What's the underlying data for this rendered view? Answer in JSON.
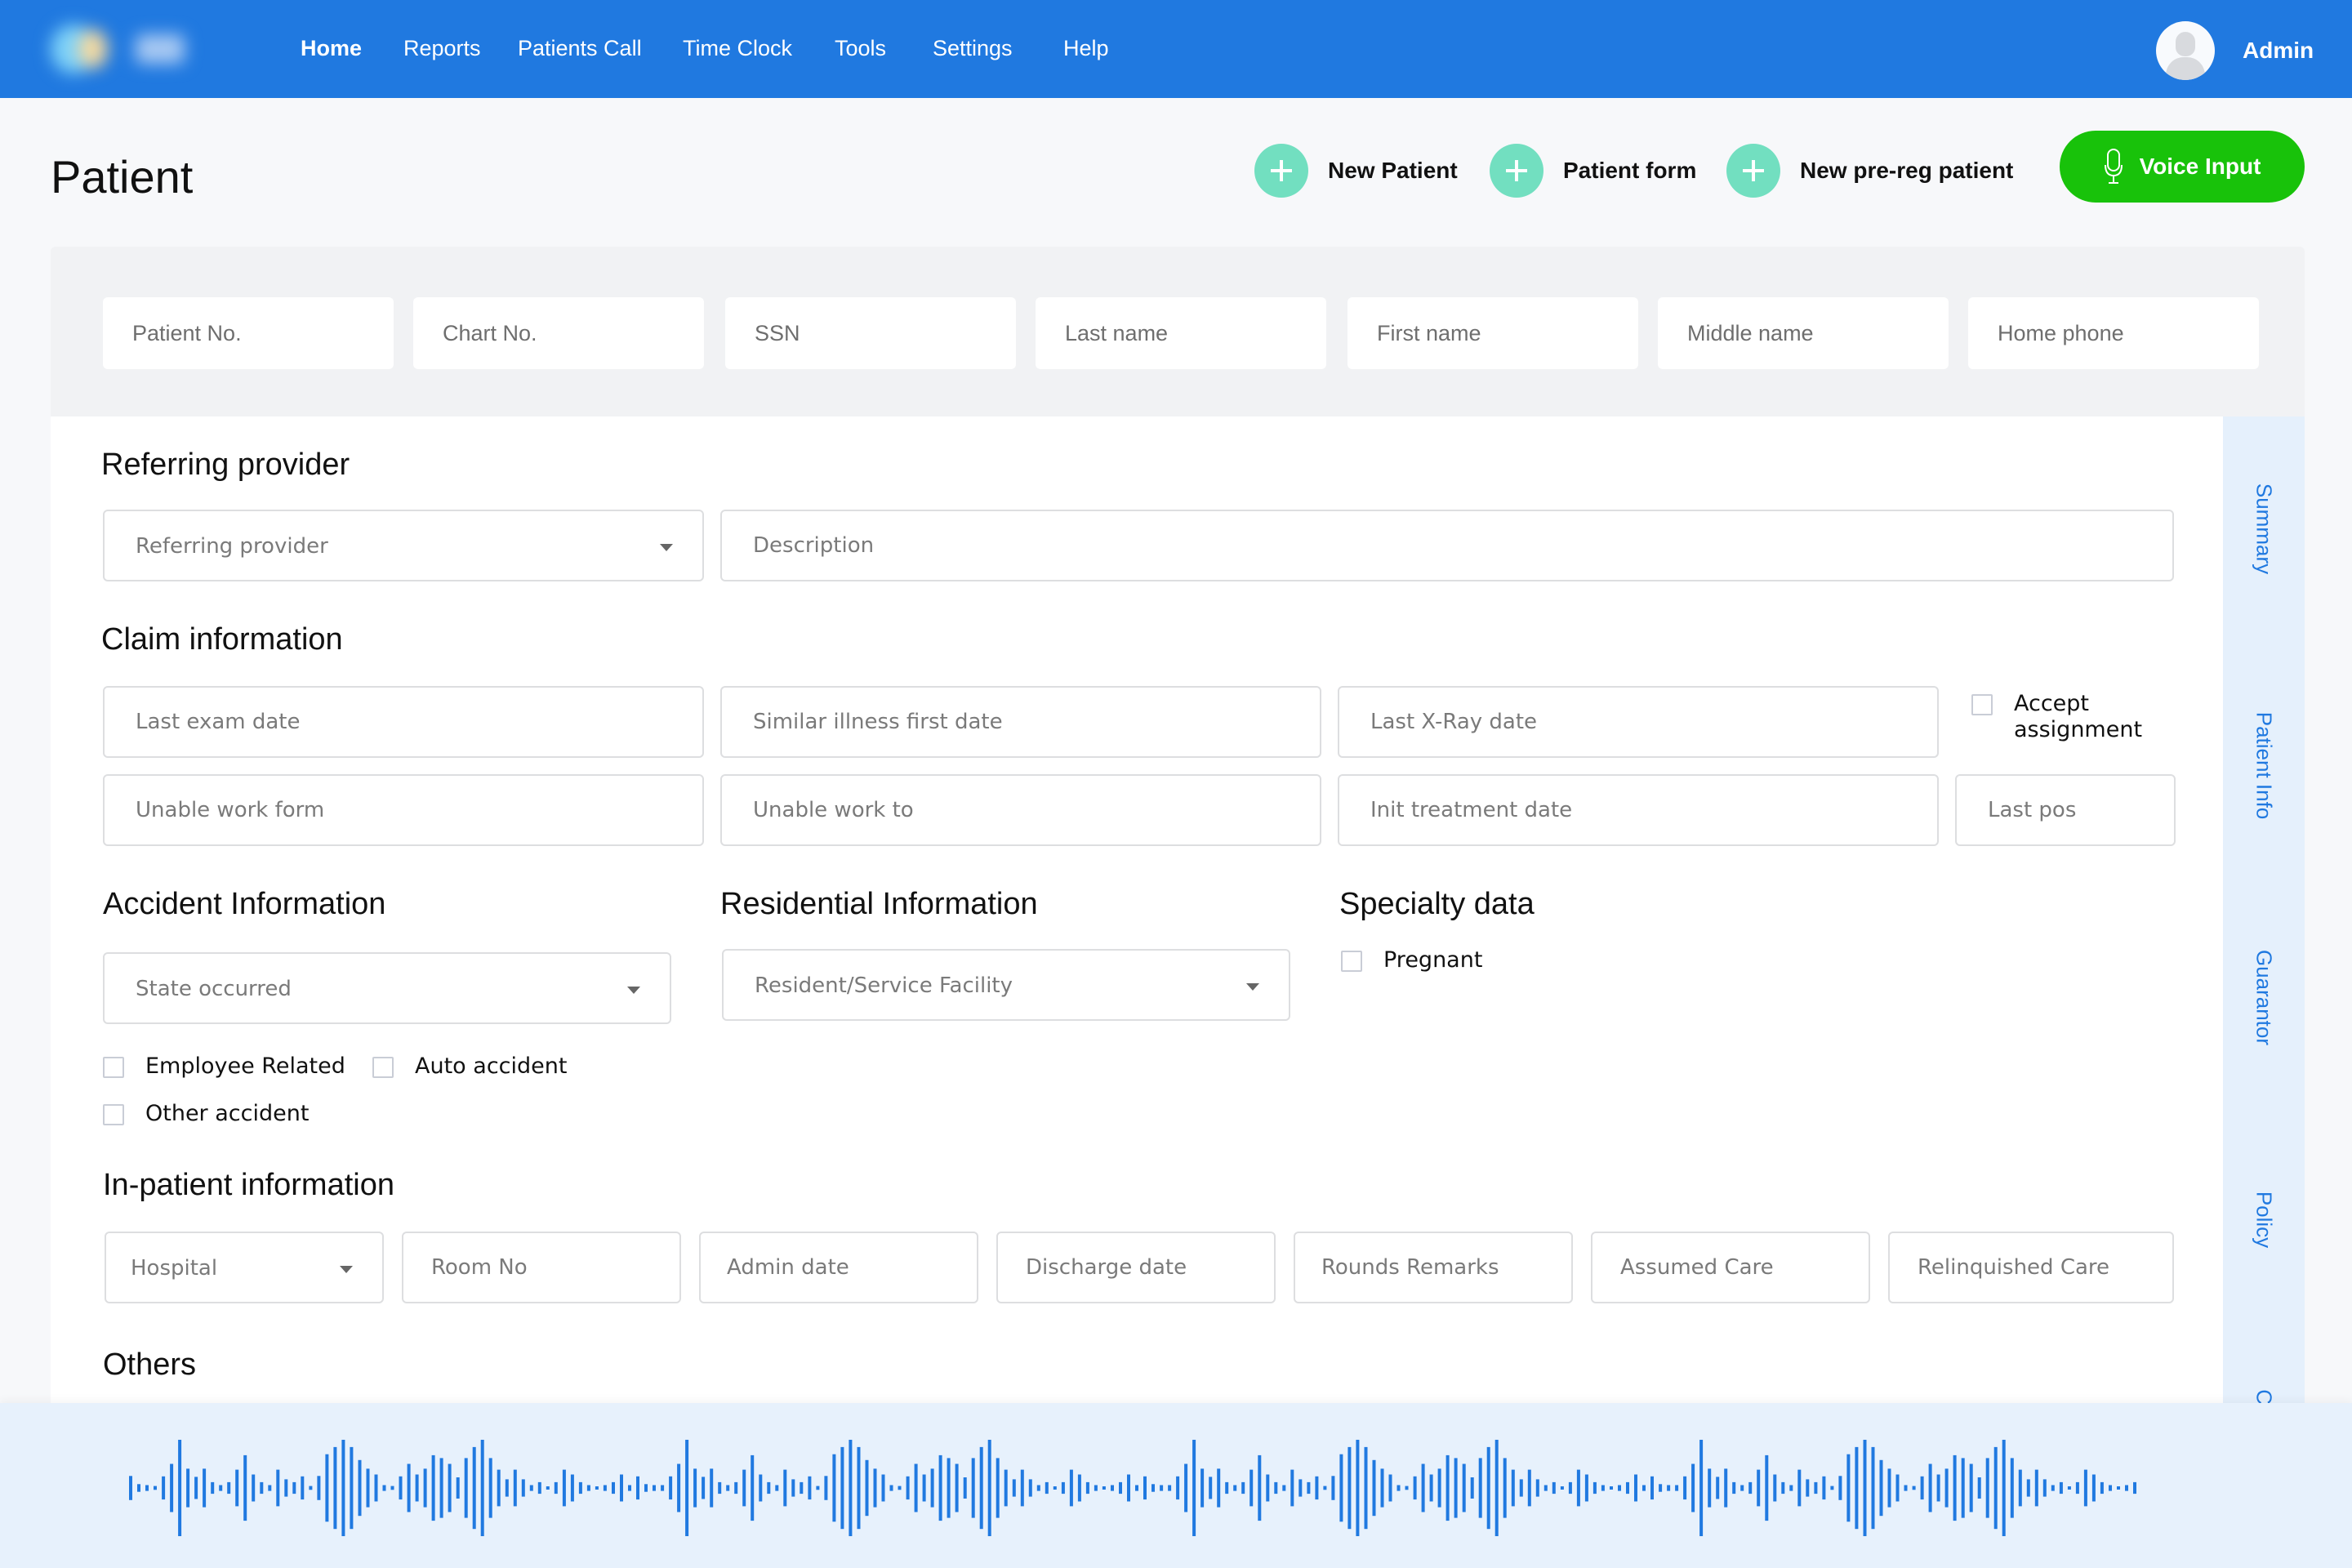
{
  "header": {
    "nav": [
      {
        "label": "Home",
        "active": true
      },
      {
        "label": "Reports",
        "active": false
      },
      {
        "label": "Patients Call",
        "active": false
      },
      {
        "label": "Time Clock",
        "active": false
      },
      {
        "label": "Tools",
        "active": false
      },
      {
        "label": "Settings",
        "active": false
      },
      {
        "label": "Help",
        "active": false
      }
    ],
    "user_name": "Admin",
    "accent_color": "#2079E0"
  },
  "page": {
    "title": "Patient",
    "actions": [
      {
        "label": "New Patient",
        "icon": "plus-circle-icon"
      },
      {
        "label": "Patient form",
        "icon": "plus-circle-icon"
      },
      {
        "label": "New pre-reg patient",
        "icon": "plus-circle-icon"
      }
    ],
    "voice_button": {
      "label": "Voice Input",
      "icon": "microphone-icon",
      "color": "#18C20A"
    }
  },
  "search": {
    "fields": [
      {
        "placeholder": "Patient No.",
        "value": ""
      },
      {
        "placeholder": "Chart No.",
        "value": ""
      },
      {
        "placeholder": "SSN",
        "value": ""
      },
      {
        "placeholder": "Last name",
        "value": ""
      },
      {
        "placeholder": "First name",
        "value": ""
      },
      {
        "placeholder": "Middle name",
        "value": ""
      },
      {
        "placeholder": "Home phone",
        "value": ""
      }
    ]
  },
  "form": {
    "referring": {
      "title": "Referring provider",
      "provider_select": "Referring provider",
      "description_placeholder": "Description"
    },
    "claim": {
      "title": "Claim information",
      "last_exam_date": "Last exam date",
      "similar_illness_first_date": "Similar illness first date",
      "last_xray_date": "Last X-Ray date",
      "accept_assignment": {
        "label": "Accept assignment",
        "checked": false
      },
      "unable_work_form": "Unable work form",
      "unable_work_to": "Unable work to",
      "init_treatment_date": "Init treatment date",
      "last_pos": "Last pos"
    },
    "accident": {
      "title": "Accident Information",
      "state_select": "State occurred",
      "employee_related": {
        "label": "Employee Related",
        "checked": false
      },
      "auto_accident": {
        "label": "Auto accident",
        "checked": false
      },
      "other_accident": {
        "label": "Other accident",
        "checked": false
      }
    },
    "residential": {
      "title": "Residential Information",
      "facility_select": "Resident/Service Facility"
    },
    "specialty": {
      "title": "Specialty data",
      "pregnant": {
        "label": "Pregnant",
        "checked": false
      }
    },
    "inpatient": {
      "title": "In-patient information",
      "hospital_select": "Hospital",
      "room_no": "Room No",
      "admin_date": "Admin date",
      "discharge_date": "Discharge date",
      "rounds_remarks": "Rounds Remarks",
      "assumed_care": "Assumed Care",
      "relinquished_care": "Relinquished Care"
    },
    "others": {
      "title": "Others"
    }
  },
  "side_tabs": [
    "Summary",
    "Patient Info",
    "Guarantor",
    "Policy",
    "Cl"
  ],
  "voice_waveform": {
    "color": "#2079E0",
    "amplitudes": [
      0.25,
      0.08,
      0.06,
      0.04,
      0.24,
      0.5,
      1.0,
      0.4,
      0.23,
      0.4,
      0.12,
      0.06,
      0.12,
      0.38,
      0.68,
      0.28,
      0.12,
      0.06,
      0.38,
      0.18,
      0.12,
      0.24,
      0.04,
      0.25,
      0.7,
      0.85,
      1.0,
      0.85,
      0.58,
      0.4,
      0.28,
      0.06,
      0.04,
      0.24,
      0.5,
      0.28,
      0.4,
      0.68,
      0.62,
      0.5,
      0.22,
      0.62,
      0.85,
      1.0,
      0.62,
      0.38,
      0.18,
      0.38,
      0.18,
      0.06,
      0.12,
      0.03,
      0.12,
      0.38,
      0.28,
      0.12,
      0.06,
      0.02,
      0.06,
      0.12,
      0.28,
      0.06,
      0.24,
      0.08,
      0.06,
      0.06,
      0.24,
      0.5,
      1.0,
      0.4,
      0.23,
      0.4,
      0.12,
      0.06,
      0.12,
      0.38,
      0.68,
      0.28,
      0.12,
      0.06,
      0.38,
      0.18,
      0.12,
      0.24,
      0.04,
      0.25,
      0.7,
      0.85,
      1.0,
      0.85,
      0.58,
      0.4,
      0.28,
      0.06,
      0.04,
      0.24,
      0.5,
      0.28,
      0.4,
      0.68,
      0.62,
      0.5,
      0.22,
      0.62,
      0.85,
      1.0,
      0.62,
      0.38,
      0.18,
      0.38,
      0.18,
      0.06,
      0.12,
      0.03,
      0.12,
      0.38,
      0.28,
      0.12,
      0.06,
      0.02,
      0.06,
      0.12,
      0.28,
      0.06,
      0.24,
      0.08,
      0.06,
      0.06,
      0.24,
      0.5,
      1.0,
      0.4,
      0.23,
      0.4,
      0.12,
      0.06,
      0.12,
      0.38,
      0.68,
      0.28,
      0.12,
      0.06,
      0.38,
      0.18,
      0.12,
      0.24,
      0.04,
      0.25,
      0.7,
      0.85,
      1.0,
      0.85,
      0.58,
      0.4,
      0.28,
      0.06,
      0.04,
      0.24,
      0.5,
      0.28,
      0.4,
      0.68,
      0.62,
      0.5,
      0.22,
      0.62,
      0.85,
      1.0,
      0.62,
      0.38,
      0.18,
      0.38,
      0.18,
      0.06,
      0.12,
      0.03,
      0.12,
      0.38,
      0.28,
      0.12,
      0.06,
      0.02,
      0.06,
      0.12,
      0.28,
      0.06,
      0.24,
      0.08,
      0.06,
      0.06,
      0.24,
      0.5,
      1.0,
      0.4,
      0.23,
      0.4,
      0.12,
      0.06,
      0.12,
      0.38,
      0.68,
      0.28,
      0.12,
      0.06,
      0.38,
      0.18,
      0.12,
      0.24,
      0.04,
      0.25,
      0.7,
      0.85,
      1.0,
      0.85,
      0.58,
      0.4,
      0.28,
      0.06,
      0.04,
      0.24,
      0.5,
      0.28,
      0.4,
      0.68,
      0.62,
      0.5,
      0.22,
      0.62,
      0.85,
      1.0,
      0.62,
      0.38,
      0.18,
      0.38,
      0.18,
      0.06,
      0.12,
      0.03,
      0.12,
      0.38,
      0.28,
      0.12,
      0.06,
      0.02,
      0.06,
      0.12
    ]
  }
}
